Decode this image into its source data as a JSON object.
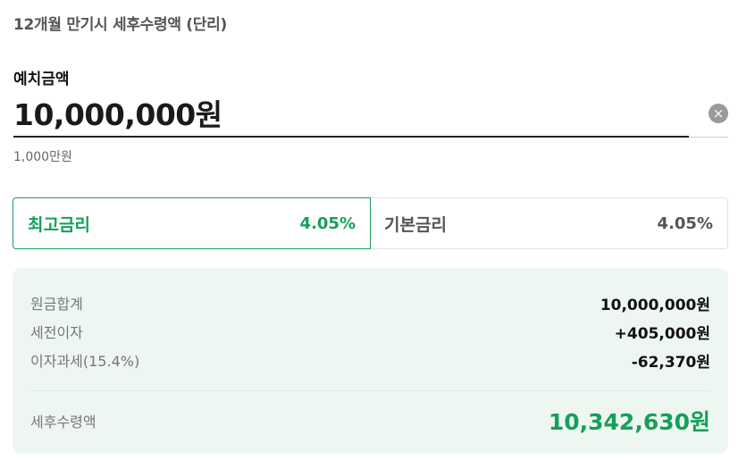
{
  "header": {
    "title": "12개월 만기시 세후수령액 (단리)"
  },
  "deposit": {
    "label": "예치금액",
    "value": "10,000,000원",
    "helper": "1,000만원",
    "clear_icon": "×"
  },
  "rates": [
    {
      "name": "최고금리",
      "value": "4.05%",
      "selected": true
    },
    {
      "name": "기본금리",
      "value": "4.05%",
      "selected": false
    }
  ],
  "summary": {
    "rows": [
      {
        "label": "원금합계",
        "value": "10,000,000원"
      },
      {
        "label": "세전이자",
        "value": "+405,000원"
      },
      {
        "label": "이자과세(15.4%)",
        "value": "-62,370원"
      }
    ],
    "total_label": "세후수령액",
    "total_value": "10,342,630원"
  },
  "colors": {
    "accent": "#14a05a",
    "summary_bg": "#eef6f1"
  }
}
